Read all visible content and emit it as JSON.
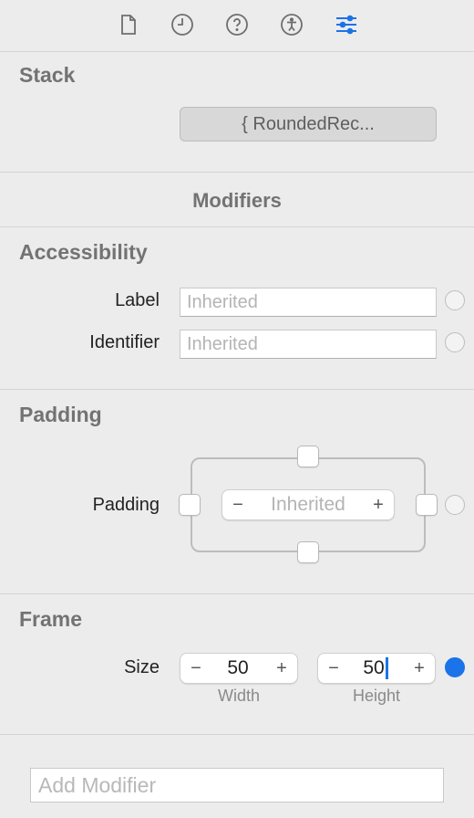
{
  "toolbar": {
    "icons": [
      "file-icon",
      "history-clock-icon",
      "help-question-icon",
      "accessibility-icon",
      "attributes-sliders-icon"
    ],
    "accent": "#1a73e8"
  },
  "stack": {
    "title": "Stack",
    "popup_value": "{ RoundedRec..."
  },
  "modifiers": {
    "title": "Modifiers"
  },
  "accessibility": {
    "title": "Accessibility",
    "label_label": "Label",
    "label_placeholder": "Inherited",
    "identifier_label": "Identifier",
    "identifier_placeholder": "Inherited"
  },
  "padding": {
    "title": "Padding",
    "row_label": "Padding",
    "stepper_minus": "−",
    "stepper_placeholder": "Inherited",
    "stepper_plus": "+"
  },
  "frame": {
    "title": "Frame",
    "size_label": "Size",
    "width": {
      "value": "50",
      "minus": "−",
      "plus": "+",
      "caption": "Width"
    },
    "height": {
      "value": "50",
      "minus": "−",
      "plus": "+",
      "caption": "Height"
    }
  },
  "add_modifier": {
    "placeholder": "Add Modifier"
  }
}
